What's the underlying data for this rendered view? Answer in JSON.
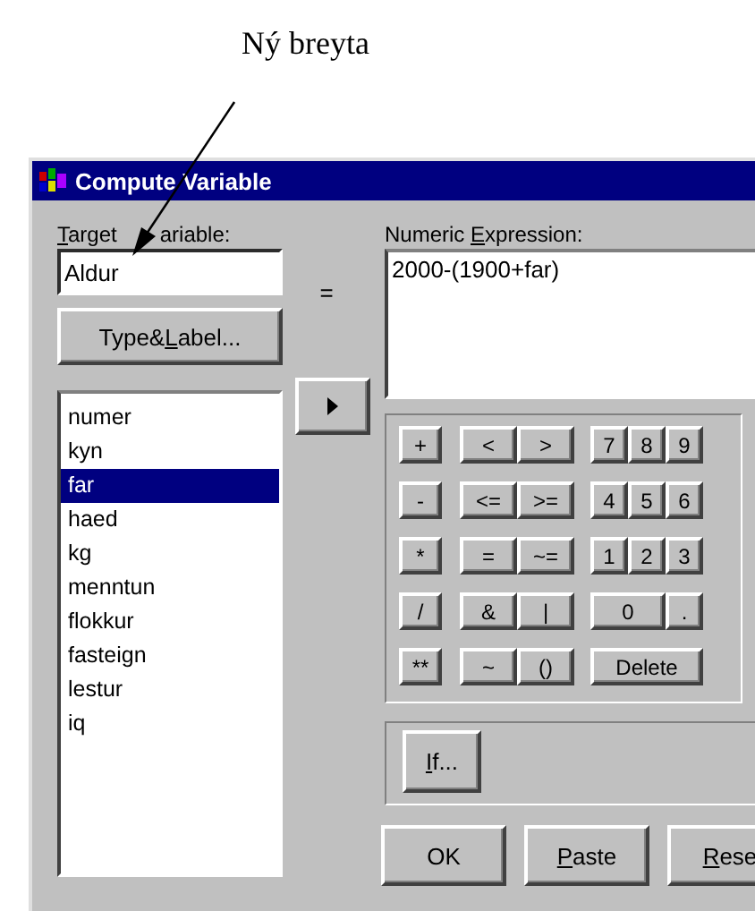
{
  "annotation": {
    "text": "Ný breyta"
  },
  "window": {
    "title": "Compute Variable"
  },
  "target_variable": {
    "label": {
      "key": "T",
      "post": "arget"
    },
    "label_visible_end": "ariable:",
    "value": "Aldur"
  },
  "equals": "=",
  "type_label_button": {
    "pre": "Type&",
    "key": "L",
    "post": "abel..."
  },
  "variables": [
    {
      "name": "numer",
      "selected": false
    },
    {
      "name": "kyn",
      "selected": false
    },
    {
      "name": "far",
      "selected": true
    },
    {
      "name": "haed",
      "selected": false
    },
    {
      "name": "kg",
      "selected": false
    },
    {
      "name": "menntun",
      "selected": false
    },
    {
      "name": "flokkur",
      "selected": false
    },
    {
      "name": "fasteign",
      "selected": false
    },
    {
      "name": "lestur",
      "selected": false
    },
    {
      "name": "iq",
      "selected": false
    }
  ],
  "numeric_expression": {
    "label": {
      "pre": "Numeric ",
      "key": "E",
      "post": "xpression:"
    },
    "value": "2000-(1900+far)"
  },
  "keypad": [
    [
      {
        "label": "+"
      },
      {
        "label": "<"
      },
      {
        "label": ">"
      },
      {
        "label": "7"
      },
      {
        "label": "8"
      },
      {
        "label": "9"
      }
    ],
    [
      {
        "label": "-"
      },
      {
        "label": "<="
      },
      {
        "label": ">="
      },
      {
        "label": "4"
      },
      {
        "label": "5"
      },
      {
        "label": "6"
      }
    ],
    [
      {
        "label": "*"
      },
      {
        "label": "="
      },
      {
        "label": "~="
      },
      {
        "label": "1"
      },
      {
        "label": "2"
      },
      {
        "label": "3"
      }
    ],
    [
      {
        "label": "/"
      },
      {
        "label": "&"
      },
      {
        "label": "|"
      },
      {
        "label": "0",
        "wide": true
      },
      {
        "label": "."
      }
    ],
    [
      {
        "label": "**"
      },
      {
        "label": "~"
      },
      {
        "label": "()"
      },
      {
        "label": "Delete",
        "wide": true
      }
    ]
  ],
  "if_button": {
    "key": "I",
    "post": "f..."
  },
  "buttons": [
    {
      "pre": "OK"
    },
    {
      "key": "P",
      "post": "aste"
    },
    {
      "key": "R",
      "post": "ese"
    }
  ]
}
